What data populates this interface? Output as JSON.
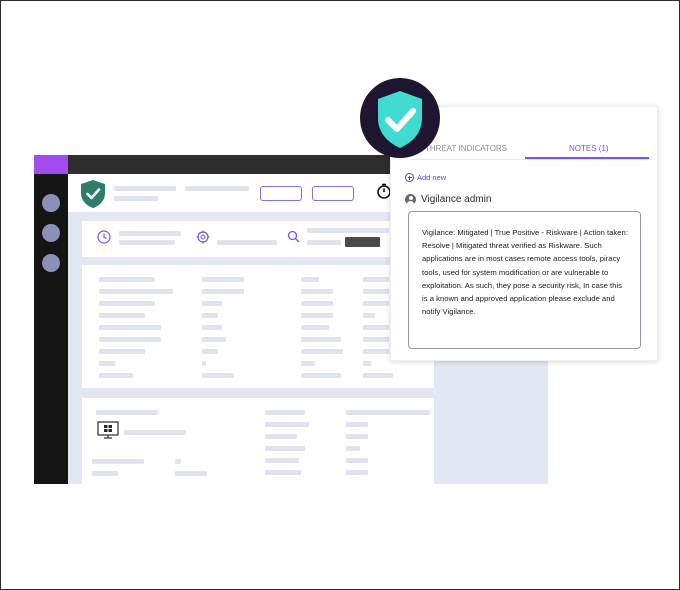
{
  "tabs": [
    {
      "label": "THREAT INDICATORS",
      "active": false
    },
    {
      "label": "NOTES (1)",
      "active": true
    }
  ],
  "add_new_label": "Add new",
  "note": {
    "author": "Vigilance admin",
    "text": "Vigilance: Mitigated | True Positive - Riskware | Action taken: Resolve | Mitigated threat verified as Riskware. Such applications are in most cases remote access tools, piracy tools, used for system modification or are vulnerable to exploitation. As such, they pose a security risk, In case this is a known and approved application please exclude and notify Vigilance."
  },
  "icons": {
    "badge": "shield-check-icon",
    "header": "shield-check-icon",
    "stopwatch": "stopwatch-icon",
    "clock": "clock-icon",
    "target": "crosshair-icon",
    "search": "search-icon",
    "monitor": "windows-monitor-icon",
    "user": "user-icon",
    "add": "plus-circle-icon"
  },
  "colors": {
    "accent": "#7b4ff0",
    "shield": "#3ddbd0",
    "shield_small": "#2e7d6b",
    "sidebar": "#141414",
    "sidebar_brand": "#a24cf0",
    "badge_bg": "#201530"
  }
}
